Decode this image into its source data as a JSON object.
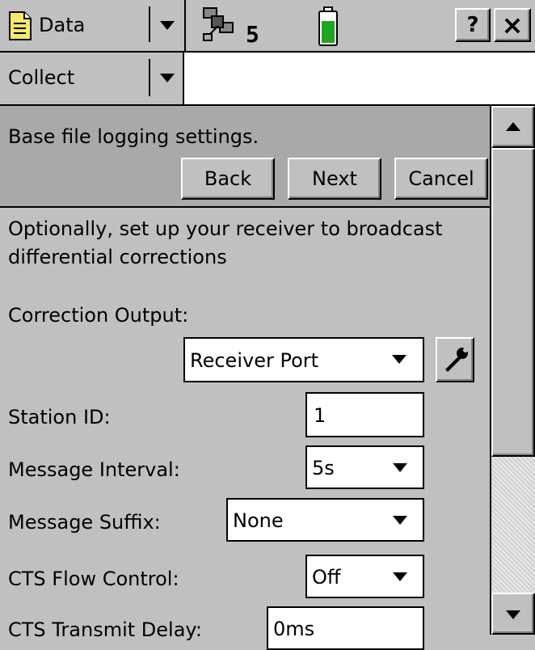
{
  "header": {
    "menu_label": "Data",
    "satellite_count": "5",
    "help_label": "?",
    "close_label": "×"
  },
  "subheader": {
    "menu_label": "Collect"
  },
  "wizard": {
    "title": "Base file logging settings.",
    "back_label": "Back",
    "next_label": "Next",
    "cancel_label": "Cancel"
  },
  "content": {
    "description": "Optionally, set up your receiver to broadcast differential corrections",
    "correction_output_label": "Correction Output:",
    "correction_output_value": "Receiver Port",
    "station_id_label": "Station ID:",
    "station_id_value": "1",
    "message_interval_label": "Message Interval:",
    "message_interval_value": "5s",
    "message_suffix_label": "Message Suffix:",
    "message_suffix_value": "None",
    "cts_flow_label": "CTS Flow Control:",
    "cts_flow_value": "Off",
    "cts_delay_label": "CTS Transmit Delay:",
    "cts_delay_value": "0ms"
  },
  "colors": {
    "background": "#c0c0c0",
    "header_panel": "#a9a9a9",
    "battery_green": "#1fa51f"
  },
  "icons": {
    "data_menu": "document-icon",
    "satellite": "satellite-icon",
    "battery": "battery-icon",
    "settings": "wrench-icon"
  }
}
